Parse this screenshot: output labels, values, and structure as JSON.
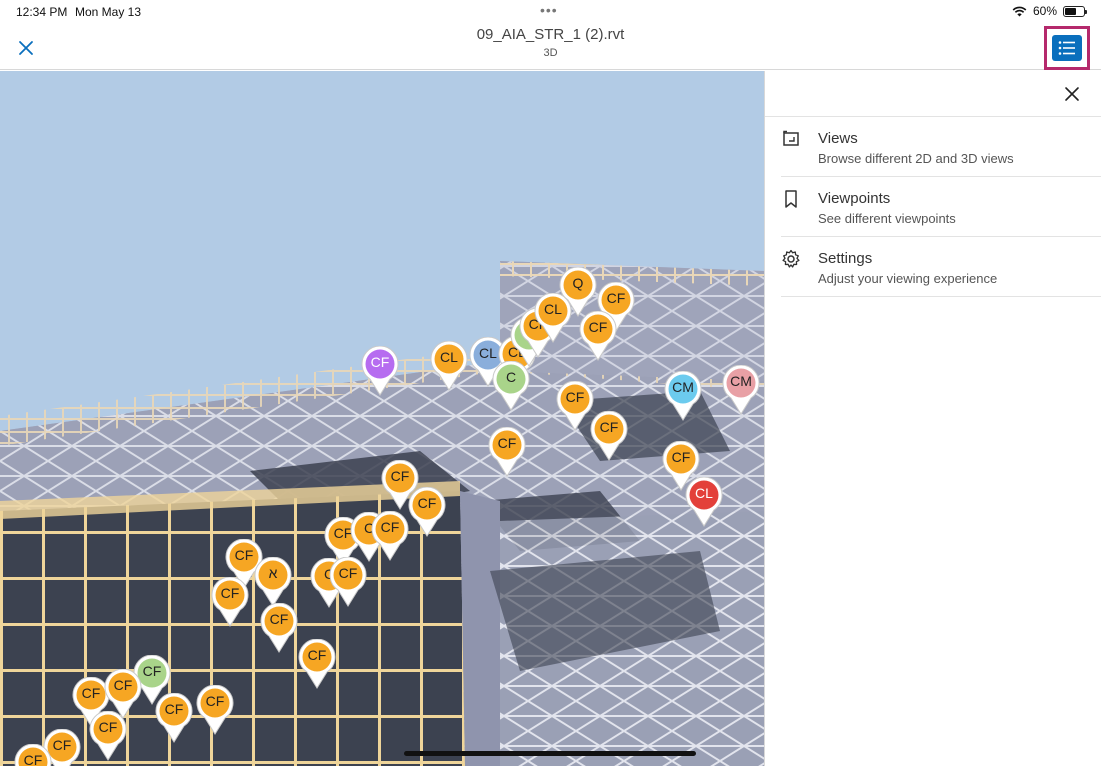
{
  "status_bar": {
    "time": "12:34 PM",
    "date": "Mon May 13",
    "dots": "•••",
    "battery": "60%",
    "battery_level": 0.6
  },
  "header": {
    "title": "09_AIA_STR_1 (2).rvt",
    "subtitle": "3D"
  },
  "icons": {
    "close": "close-icon",
    "list": "list-icon",
    "views": "views-icon",
    "viewpoints": "bookmark-icon",
    "settings": "gear-icon",
    "wifi": "wifi-icon",
    "battery": "battery-icon"
  },
  "colors": {
    "accent": "#0a6fbd",
    "highlight": "#b5296c",
    "pin_orange": "#f6a623",
    "pin_red": "#e3403a",
    "pin_green": "#a9d48a",
    "pin_blue": "#8aaedb",
    "pin_purple": "#b66cf0",
    "pin_cyan": "#6ccbee",
    "pin_pink": "#e8a0a5",
    "sky": "#b2cbe5"
  },
  "panel": {
    "items": [
      {
        "label": "Views",
        "description": "Browse different 2D and 3D views"
      },
      {
        "label": "Viewpoints",
        "description": "See different viewpoints"
      },
      {
        "label": "Settings",
        "description": "Adjust your viewing experience"
      }
    ]
  },
  "pins": [
    {
      "text": "CF",
      "color": "purple"
    },
    {
      "text": "CL",
      "color": "orange"
    },
    {
      "text": "CL",
      "color": "blue"
    },
    {
      "text": "CL",
      "color": "orange"
    },
    {
      "text": "C",
      "color": "green"
    },
    {
      "text": "C",
      "color": "green"
    },
    {
      "text": "CF",
      "color": "orange"
    },
    {
      "text": "CL",
      "color": "orange"
    },
    {
      "text": "Q",
      "color": "orange"
    },
    {
      "text": "CF",
      "color": "orange"
    },
    {
      "text": "CF",
      "color": "orange"
    },
    {
      "text": "CM",
      "color": "cyan"
    },
    {
      "text": "CM",
      "color": "pink"
    },
    {
      "text": "CF",
      "color": "orange"
    },
    {
      "text": "CF",
      "color": "orange"
    },
    {
      "text": "CF",
      "color": "orange"
    },
    {
      "text": "CF",
      "color": "orange"
    },
    {
      "text": "CL",
      "color": "red"
    },
    {
      "text": "CF",
      "color": "orange"
    },
    {
      "text": "CF",
      "color": "orange"
    },
    {
      "text": "CF",
      "color": "orange"
    },
    {
      "text": "C",
      "color": "orange"
    },
    {
      "text": "CF",
      "color": "orange"
    },
    {
      "text": "CF",
      "color": "orange"
    },
    {
      "text": "א",
      "color": "orange"
    },
    {
      "text": "C",
      "color": "orange"
    },
    {
      "text": "CF",
      "color": "orange"
    },
    {
      "text": "CF",
      "color": "orange"
    },
    {
      "text": "CF",
      "color": "orange"
    },
    {
      "text": "CF",
      "color": "orange"
    },
    {
      "text": "CF",
      "color": "green"
    },
    {
      "text": "CF",
      "color": "orange"
    },
    {
      "text": "CF",
      "color": "orange"
    },
    {
      "text": "CF",
      "color": "orange"
    },
    {
      "text": "CF",
      "color": "orange"
    },
    {
      "text": "CF",
      "color": "orange"
    },
    {
      "text": "CF",
      "color": "orange"
    },
    {
      "text": "CF",
      "color": "orange"
    }
  ]
}
